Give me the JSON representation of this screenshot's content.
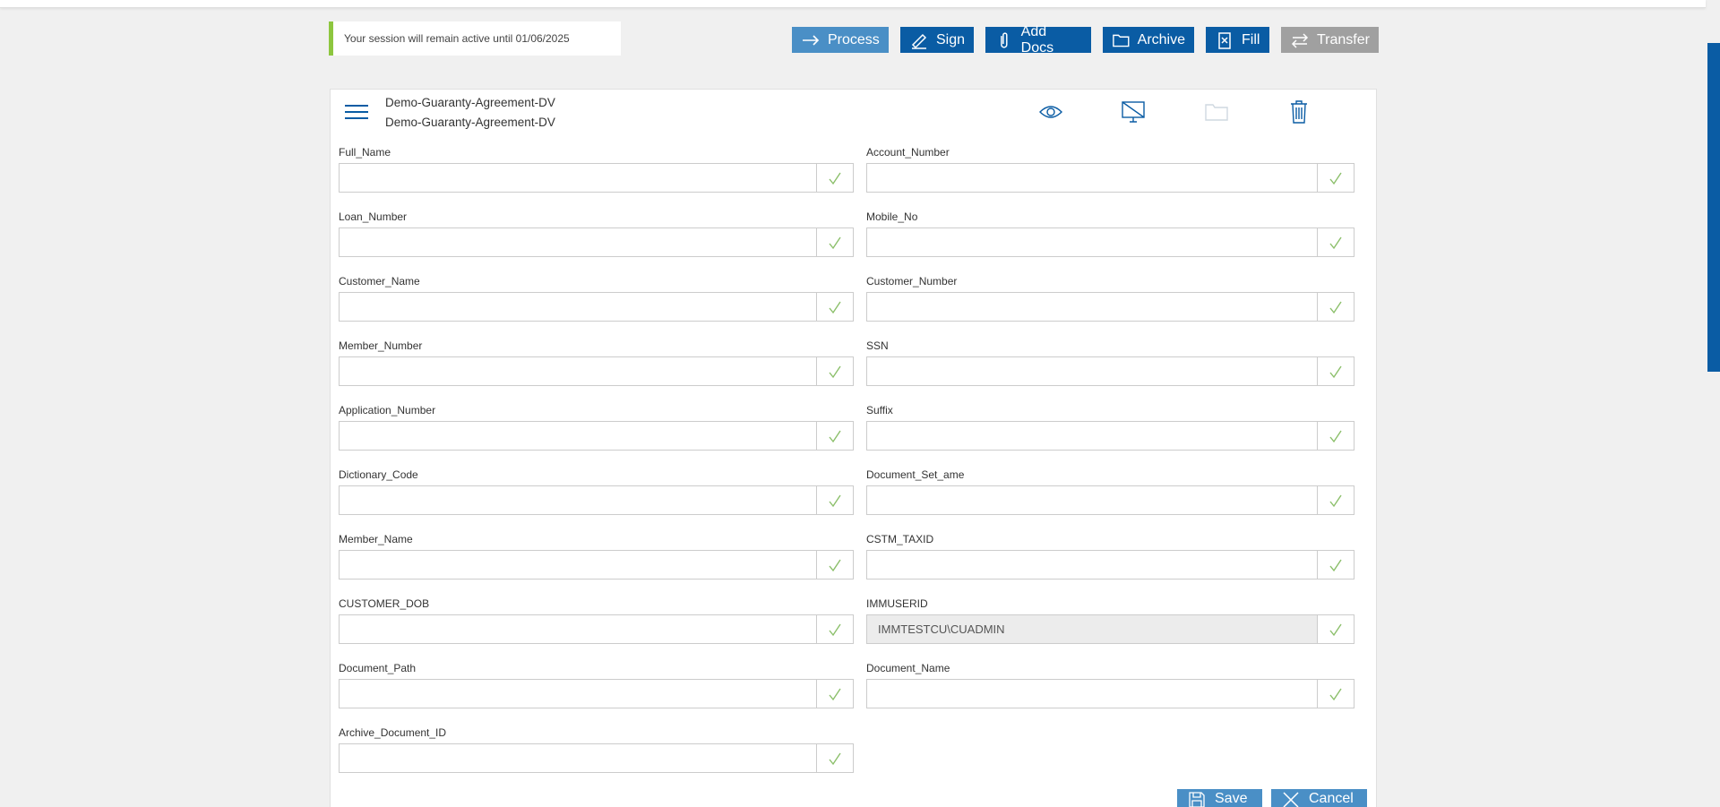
{
  "session": {
    "text": "Your session will remain active until 01/06/2025"
  },
  "toolbar": {
    "process": "Process",
    "sign": "Sign",
    "add_docs": "Add Docs",
    "archive": "Archive",
    "fill": "Fill",
    "transfer": "Transfer"
  },
  "document": {
    "title_line1": "Demo-Guaranty-Agreement-DV",
    "title_line2": "Demo-Guaranty-Agreement-DV"
  },
  "fields": {
    "full_name": {
      "label": "Full_Name",
      "value": ""
    },
    "account_number": {
      "label": "Account_Number",
      "value": ""
    },
    "loan_number": {
      "label": "Loan_Number",
      "value": ""
    },
    "mobile_no": {
      "label": "Mobile_No",
      "value": ""
    },
    "customer_name": {
      "label": "Customer_Name",
      "value": ""
    },
    "customer_number": {
      "label": "Customer_Number",
      "value": ""
    },
    "member_number": {
      "label": "Member_Number",
      "value": ""
    },
    "ssn": {
      "label": "SSN",
      "value": ""
    },
    "application_number": {
      "label": "Application_Number",
      "value": ""
    },
    "suffix": {
      "label": "Suffix",
      "value": ""
    },
    "dictionary_code": {
      "label": "Dictionary_Code",
      "value": ""
    },
    "document_set_name": {
      "label": "Document_Set_ame",
      "value": ""
    },
    "member_name": {
      "label": "Member_Name",
      "value": ""
    },
    "cstm_taxid": {
      "label": "CSTM_TAXID",
      "value": ""
    },
    "customer_dob": {
      "label": "CUSTOMER_DOB",
      "value": ""
    },
    "immuserid": {
      "label": "IMMUSERID",
      "value": "IMMTESTCU\\CUADMIN"
    },
    "document_path": {
      "label": "Document_Path",
      "value": ""
    },
    "document_name": {
      "label": "Document_Name",
      "value": ""
    },
    "archive_document_id": {
      "label": "Archive_Document_ID",
      "value": ""
    }
  },
  "footer": {
    "save": "Save",
    "cancel": "Cancel"
  },
  "colors": {
    "primary": "#0a5ca4",
    "process_blue": "#4a8fc6",
    "transfer_gray": "#a0a0a0",
    "session_accent": "#8dc63f",
    "check_green": "#8bbf6a"
  },
  "icons": {
    "process": "arrow-right-icon",
    "sign": "pen-icon",
    "add_docs": "paperclip-icon",
    "archive": "folder-icon",
    "fill": "fill-form-icon",
    "transfer": "swap-arrows-icon",
    "menu": "hamburger-icon",
    "view": "eye-icon",
    "no_display": "monitor-off-icon",
    "folder": "folder-icon",
    "delete": "trash-icon",
    "valid": "checkmark-icon",
    "save": "floppy-icon",
    "cancel": "close-icon"
  }
}
